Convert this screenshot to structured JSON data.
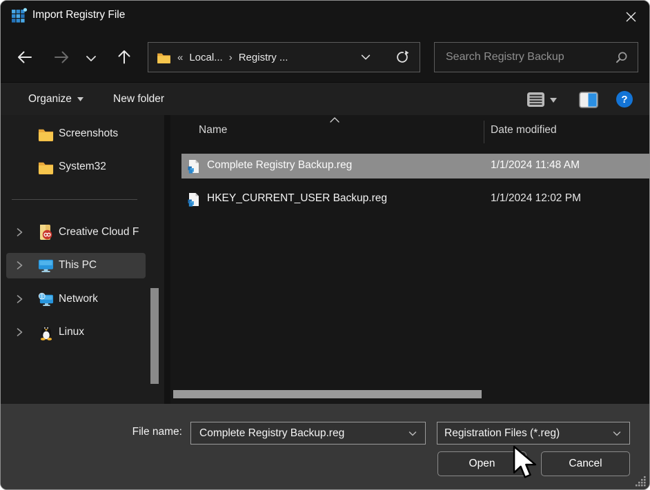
{
  "window": {
    "title": "Import Registry File"
  },
  "nav": {
    "breadcrumb": {
      "collapsed": "«",
      "folder1": "Local...",
      "separator": "›",
      "folder2": "Registry ..."
    },
    "search_placeholder": "Search Registry Backup"
  },
  "commandbar": {
    "organize": "Organize",
    "new_folder": "New folder",
    "help": "?"
  },
  "sidebar": {
    "items": [
      {
        "label": "Screenshots"
      },
      {
        "label": "System32"
      },
      {
        "label": "Creative Cloud F"
      },
      {
        "label": "This PC"
      },
      {
        "label": "Network"
      },
      {
        "label": "Linux"
      }
    ]
  },
  "filelist": {
    "columns": {
      "name": "Name",
      "date": "Date modified"
    },
    "rows": [
      {
        "name": "Complete Registry Backup.reg",
        "date": "1/1/2024 11:48 AM"
      },
      {
        "name": "HKEY_CURRENT_USER Backup.reg",
        "date": "1/1/2024 12:02 PM"
      }
    ]
  },
  "footer": {
    "file_name_label": "File name:",
    "file_name_value": "Complete Registry Backup.reg",
    "file_type_value": "Registration Files (*.reg)",
    "open": "Open",
    "cancel": "Cancel"
  },
  "colors": {
    "accent_blue": "#1374d6",
    "selection_gray": "#8d8d8d",
    "folder_yellow": "#f6c64d"
  }
}
